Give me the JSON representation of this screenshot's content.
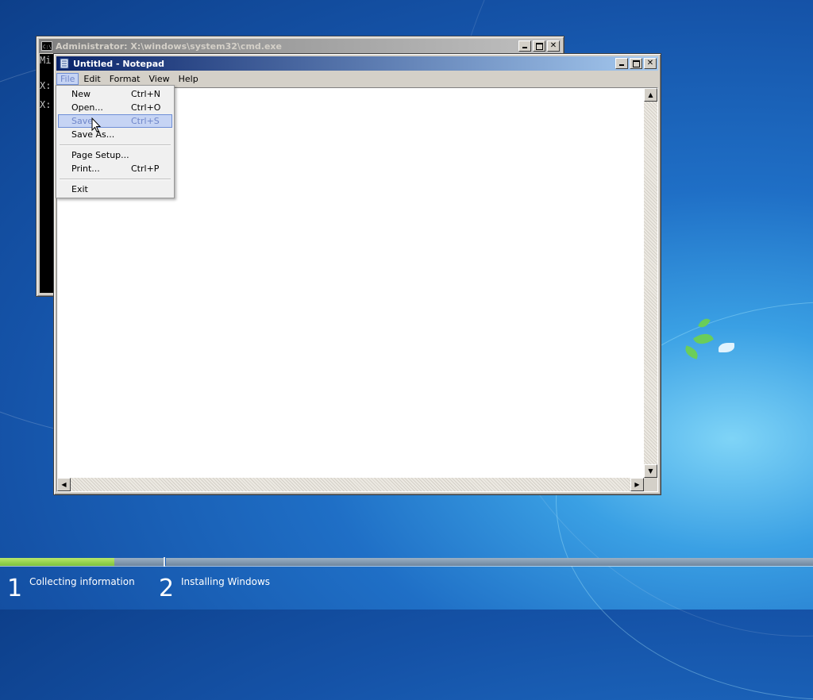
{
  "cmd_window": {
    "title": "Administrator: X:\\windows\\system32\\cmd.exe",
    "console_lines": [
      "Mi",
      "",
      "X:",
      "",
      "X:"
    ],
    "buttons": [
      "minimize",
      "maximize",
      "close"
    ]
  },
  "notepad_window": {
    "title": "Untitled - Notepad",
    "menu": [
      "File",
      "Edit",
      "Format",
      "View",
      "Help"
    ],
    "active_menu": "File"
  },
  "file_menu": {
    "items": [
      {
        "label": "New",
        "shortcut": "Ctrl+N"
      },
      {
        "label": "Open...",
        "shortcut": "Ctrl+O"
      },
      {
        "label": "Save",
        "shortcut": "Ctrl+S",
        "highlighted": true
      },
      {
        "label": "Save As...",
        "shortcut": ""
      },
      {
        "label": "Page Setup...",
        "shortcut": ""
      },
      {
        "label": "Print...",
        "shortcut": "Ctrl+P"
      },
      {
        "label": "Exit",
        "shortcut": ""
      }
    ]
  },
  "setup_progress": {
    "steps": [
      {
        "number": "1",
        "label": "Collecting information"
      },
      {
        "number": "2",
        "label": "Installing Windows"
      }
    ],
    "collecting_progress": 0.7
  },
  "colors": {
    "title_active": "#0a246a",
    "menu_highlight": "#c6d4f4",
    "progress_fill": "#7cc23c"
  }
}
